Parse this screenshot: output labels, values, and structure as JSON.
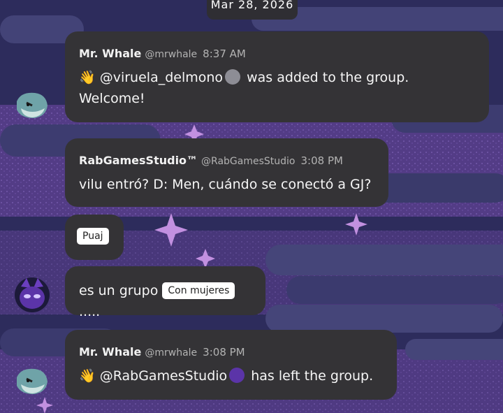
{
  "date_label": "Mar 28, 2026",
  "messages": [
    {
      "author": "Mr. Whale",
      "handle": "@mrwhale",
      "time": "8:37 AM",
      "emoji": "👋",
      "mention": "@viruela_delmono",
      "text_after": "was added to the group.",
      "text_line2": "Welcome!"
    },
    {
      "author": "RabGamesStudio™",
      "handle": "@RabGamesStudio",
      "time": "3:08 PM",
      "text": "vilu entró? D: Men, cuándo se conectó a GJ?"
    },
    {
      "sticker_label": "Puaj"
    },
    {
      "text_before": "es un grupo",
      "sticker_label": "Con mujeres",
      "text_after": "....."
    },
    {
      "author": "Mr. Whale",
      "handle": "@mrwhale",
      "time": "3:08 PM",
      "emoji": "👋",
      "mention": "@RabGamesStudio",
      "text_after": "has left the group."
    }
  ],
  "colors": {
    "bubble": "#343336",
    "background": "#2b2a57",
    "cloud": "#46457a",
    "sparkle": "#b48ad6"
  }
}
